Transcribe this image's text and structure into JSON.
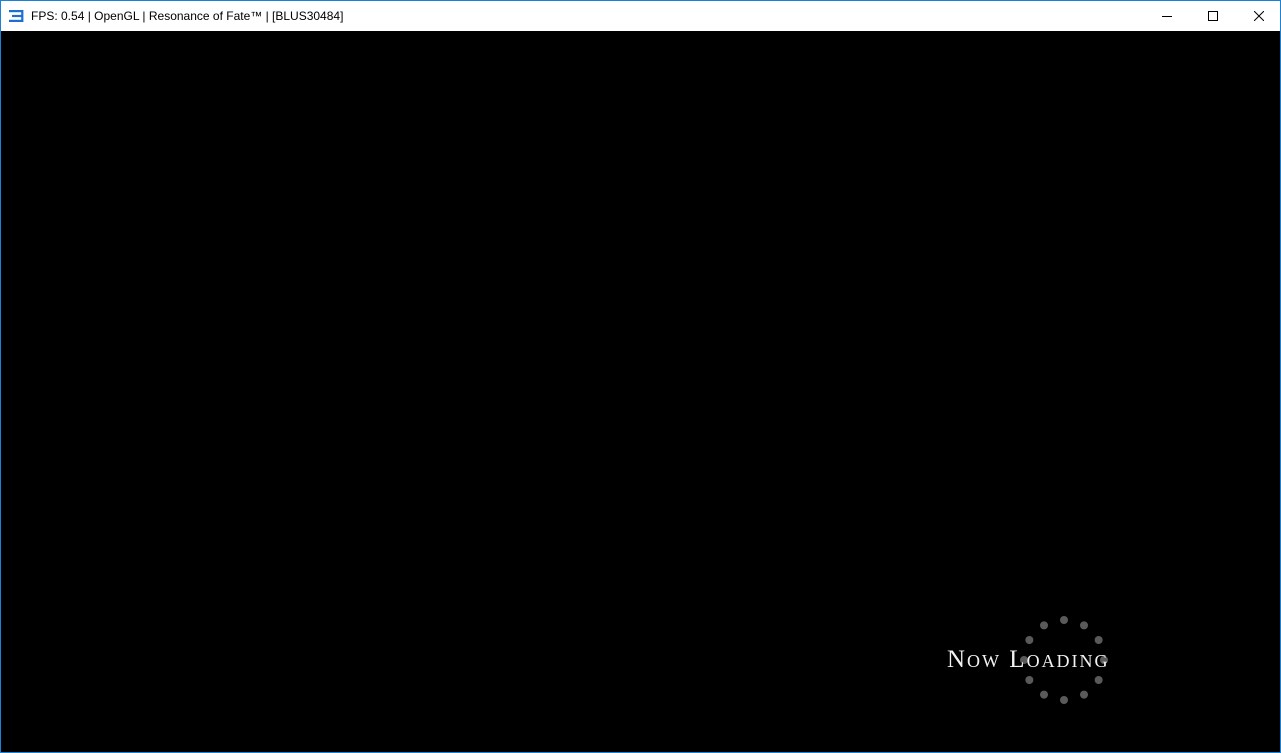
{
  "window": {
    "title": "FPS: 0.54 | OpenGL | Resonance of Fate™ | [BLUS30484]",
    "app_icon": "rpcs3-icon",
    "controls": {
      "minimize_icon": "minimize-icon",
      "maximize_icon": "maximize-icon",
      "close_icon": "close-icon"
    },
    "border_color": "#1883d7"
  },
  "game": {
    "background_color": "#000000",
    "loading_text": "Now Loading",
    "loading_text_color": "#f2f2f2",
    "spinner_dot_color": "#5a5a5a",
    "spinner_dot_count": 12
  }
}
